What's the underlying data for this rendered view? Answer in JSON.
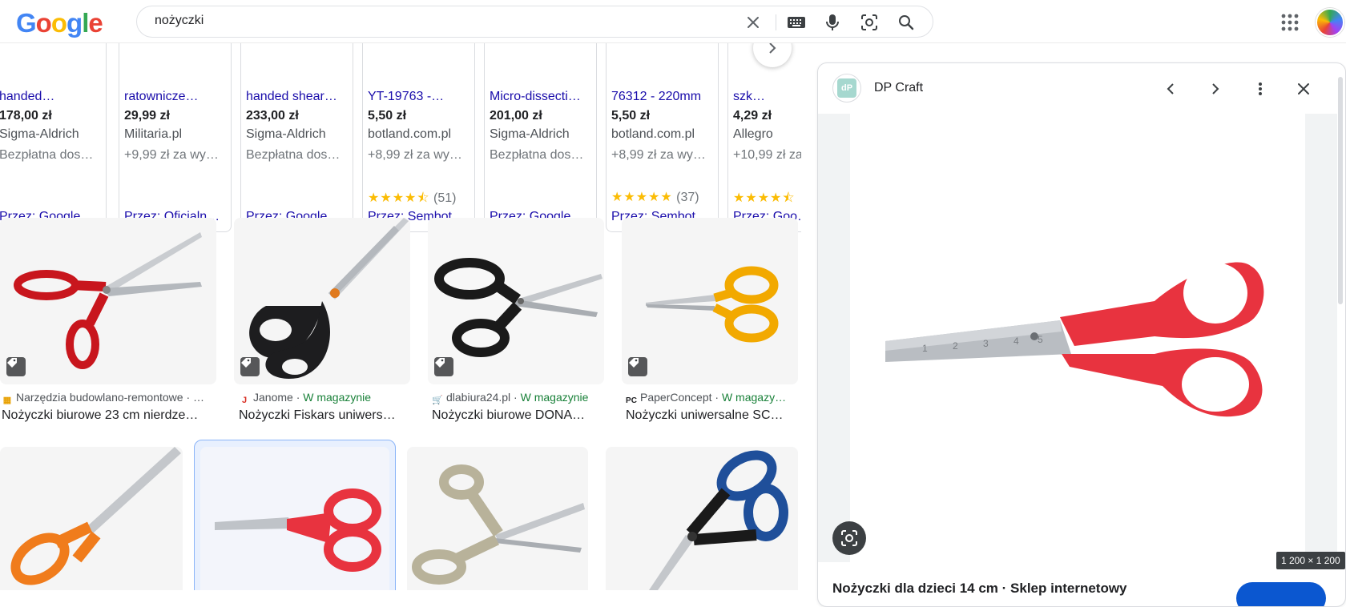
{
  "search": {
    "query": "nożyczki"
  },
  "logo": {
    "letters": [
      "G",
      "o",
      "o",
      "g",
      "l",
      "e"
    ]
  },
  "shopping_cards": [
    {
      "title": "handed…",
      "price": "178,00 zł",
      "shop": "Sigma-Aldrich",
      "shipping": "Bezpłatna dos…",
      "rating": "",
      "rating_count": "",
      "via": "Przez: Google"
    },
    {
      "title": "ratownicze…",
      "price": "29,99 zł",
      "shop": "Militaria.pl",
      "shipping": "+9,99 zł za wy…",
      "rating": "",
      "rating_count": "",
      "via": "Przez: Oficjaln…"
    },
    {
      "title": "handed shear…",
      "price": "233,00 zł",
      "shop": "Sigma-Aldrich",
      "shipping": "Bezpłatna dos…",
      "rating": "",
      "rating_count": "",
      "via": "Przez: Google"
    },
    {
      "title": "YT-19763 -…",
      "price": "5,50 zł",
      "shop": "botland.com.pl",
      "shipping": "+8,99 zł za wy…",
      "rating": "★★★★⯪",
      "rating_count": "(51)",
      "via": "Przez: Sembot"
    },
    {
      "title": "Micro-dissecti…",
      "price": "201,00 zł",
      "shop": "Sigma-Aldrich",
      "shipping": "Bezpłatna dos…",
      "rating": "",
      "rating_count": "",
      "via": "Przez: Google"
    },
    {
      "title": "76312 - 220mm",
      "price": "5,50 zł",
      "shop": "botland.com.pl",
      "shipping": "+8,99 zł za wy…",
      "rating": "★★★★★",
      "rating_count": "(37)",
      "via": "Przez: Sembot"
    },
    {
      "title": "szk…",
      "price": "4,29 zł",
      "shop": "Allegro",
      "shipping": "+10,99 zł za",
      "rating": "★★★★⯪",
      "rating_count": "",
      "via": "Przez: Goo…"
    }
  ],
  "image_results_row1": [
    {
      "source": "Narzędzia budowlano-remontowe · …",
      "stock": "",
      "title": "Nożyczki biurowe 23 cm nierdze…",
      "favicon": "▦",
      "handle_color": "#c8161d"
    },
    {
      "source": "Janome · ",
      "stock": "W magazynie",
      "title": "Nożyczki Fiskars uniwers…",
      "favicon": "J",
      "handle_color": "#1d1d1f"
    },
    {
      "source": "dlabiura24.pl · ",
      "stock": "W magazynie",
      "title": "Nożyczki biurowe DONA…",
      "favicon": "🛒",
      "handle_color": "#1a1a1a"
    },
    {
      "source": "PaperConcept · ",
      "stock": "W magazy…",
      "title": "Nożyczki uniwersalne SC…",
      "favicon": "PC",
      "handle_color": "#f2a900"
    }
  ],
  "image_results_row2": [
    {
      "handle_color": "#f07c1c"
    },
    {
      "handle_color": "#e8333f"
    },
    {
      "handle_color": "#b8b29a"
    },
    {
      "handle_color": "#1f4f9a"
    }
  ],
  "panel": {
    "site_name": "DP Craft",
    "site_icon_text": "dP",
    "dimensions": "1 200 × 1 200",
    "caption": "Nożyczki dla dzieci 14 cm · Sklep internetowy"
  },
  "colors": {
    "link": "#1a0dab",
    "stock_green": "#188038",
    "accent": "#0b57d0"
  }
}
